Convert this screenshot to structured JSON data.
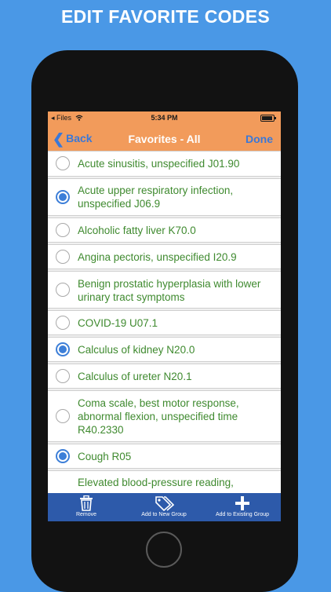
{
  "headline": "EDIT FAVORITE CODES",
  "status_bar": {
    "back_app": "◂ Files",
    "time": "5:34 PM"
  },
  "nav": {
    "back_label": "Back",
    "title": "Favorites - All",
    "done_label": "Done"
  },
  "list": {
    "items": [
      {
        "text": "Acute sinusitis, unspecified J01.90",
        "selected": false
      },
      {
        "text": "Acute upper respiratory infection, unspecified J06.9",
        "selected": true
      },
      {
        "text": "Alcoholic fatty liver K70.0",
        "selected": false
      },
      {
        "text": "Angina pectoris, unspecified I20.9",
        "selected": false
      },
      {
        "text": "Benign prostatic hyperplasia with lower urinary tract symptoms",
        "selected": false
      },
      {
        "text": "COVID-19 U07.1",
        "selected": false
      },
      {
        "text": "Calculus of kidney N20.0",
        "selected": true
      },
      {
        "text": "Calculus of ureter N20.1",
        "selected": false
      },
      {
        "text": "Coma scale, best motor response, abnormal flexion, unspecified time R40.2330",
        "selected": false
      },
      {
        "text": "Cough R05",
        "selected": true
      },
      {
        "text": "Elevated blood-pressure reading,",
        "selected": false
      }
    ]
  },
  "toolbar": {
    "remove_label": "Remove",
    "add_new_label": "Add to New Group",
    "add_existing_label": "Add to Existing Group"
  },
  "colors": {
    "background": "#4a98e6",
    "nav_bar": "#f29b5b",
    "link": "#3a78d8",
    "item_text": "#3f8a2f",
    "toolbar": "#2d5aaa",
    "radio_selected": "#3d7fd8"
  }
}
